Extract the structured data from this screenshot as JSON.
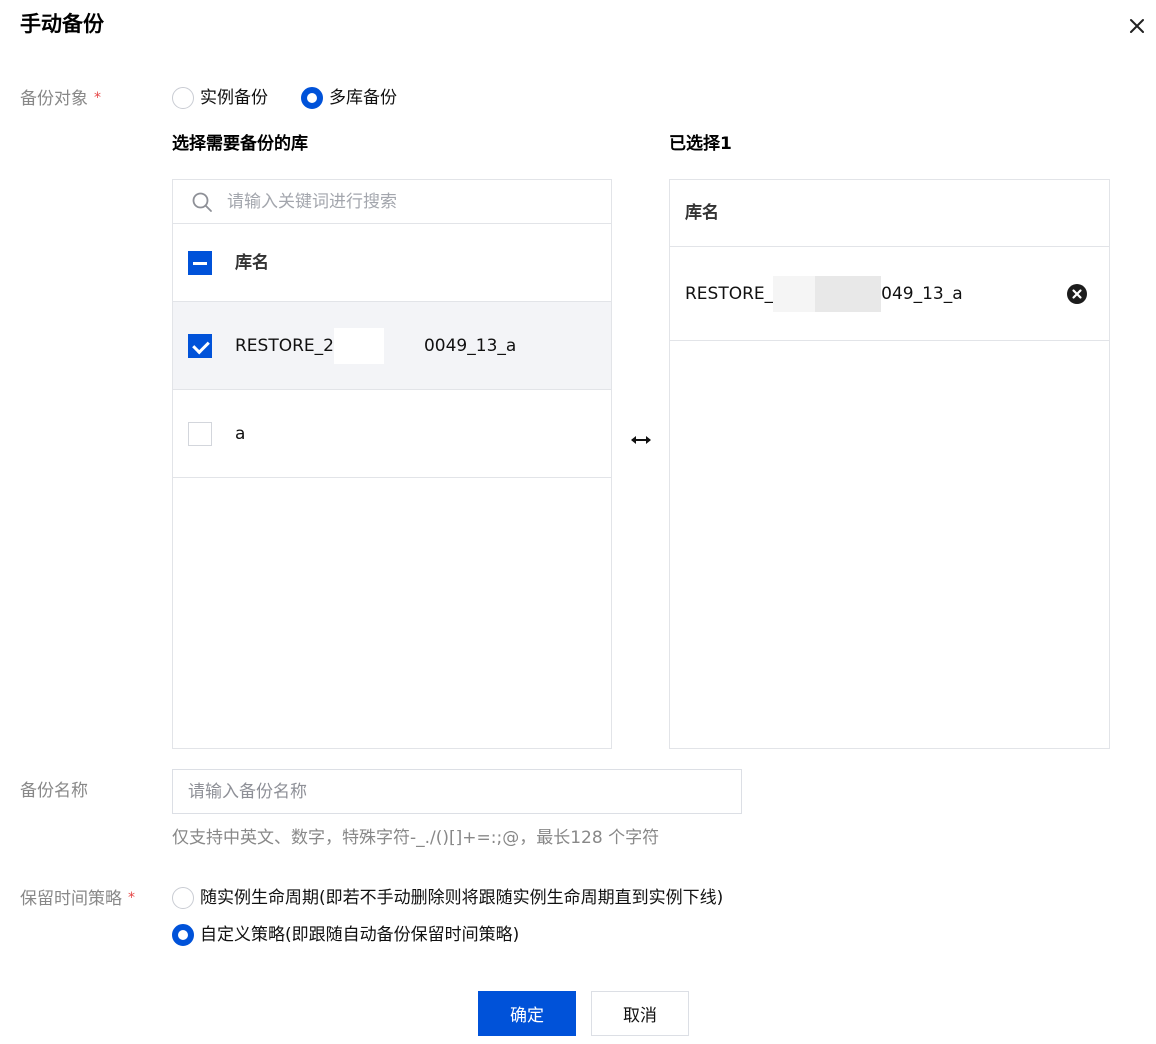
{
  "dialog": {
    "title": "手动备份",
    "close_icon": "close-icon"
  },
  "backup_target": {
    "label": "备份对象",
    "required_mark": "*",
    "options": [
      {
        "label": "实例备份",
        "selected": false
      },
      {
        "label": "多库备份",
        "selected": true
      }
    ]
  },
  "left_panel": {
    "title": "选择需要备份的库",
    "search_placeholder": "请输入关键词进行搜索",
    "header": "库名",
    "header_checkbox_state": "indeterminate",
    "rows": [
      {
        "name_prefix": "RESTORE_2",
        "name_suffix": "0049_13_a",
        "checked": true
      },
      {
        "name_prefix": "a",
        "name_suffix": "",
        "checked": false
      }
    ]
  },
  "right_panel": {
    "title": "已选择1",
    "header": "库名",
    "rows": [
      {
        "name_prefix": "RESTORE_",
        "name_suffix": "049_13_a"
      }
    ]
  },
  "backup_name": {
    "label": "备份名称",
    "placeholder": "请输入备份名称",
    "value": "",
    "hint": "仅支持中英文、数字，特殊字符-_./()[]+=:;@，最长128 个字符"
  },
  "retention": {
    "label": "保留时间策略",
    "required_mark": "*",
    "options": [
      {
        "label": "随实例生命周期(即若不手动删除则将跟随实例生命周期直到实例下线)",
        "selected": false
      },
      {
        "label": "自定义策略(即跟随自动备份保留时间策略)",
        "selected": true
      }
    ]
  },
  "footer": {
    "confirm": "确定",
    "cancel": "取消"
  },
  "colors": {
    "primary": "#0052d9",
    "required": "#e54545",
    "label": "#888888",
    "border": "#e2e4e8"
  }
}
